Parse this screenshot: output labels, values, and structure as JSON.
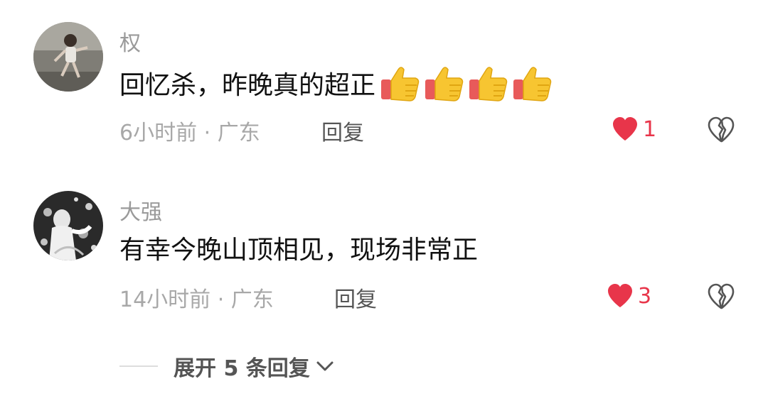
{
  "comments": [
    {
      "username": "权",
      "text": "回忆杀，昨晚真的超正",
      "emoji_icons": [
        "thumbs-up-icon",
        "thumbs-up-icon",
        "thumbs-up-icon",
        "thumbs-up-icon"
      ],
      "time": "6小时前",
      "location": "广东",
      "meta": "6小时前 · 广东",
      "reply_label": "回复",
      "like_count": "1"
    },
    {
      "username": "大强",
      "text": "有幸今晚山顶相见，现场非常正",
      "time": "14小时前",
      "location": "广东",
      "meta": "14小时前 · 广东",
      "reply_label": "回复",
      "like_count": "3"
    }
  ],
  "expand_replies": {
    "label": "展开 5 条回复"
  },
  "colors": {
    "like_red": "#e8354a",
    "username_gray": "#9a9a9a",
    "meta_gray": "#a8a8a8",
    "text_dark": "#111111"
  }
}
